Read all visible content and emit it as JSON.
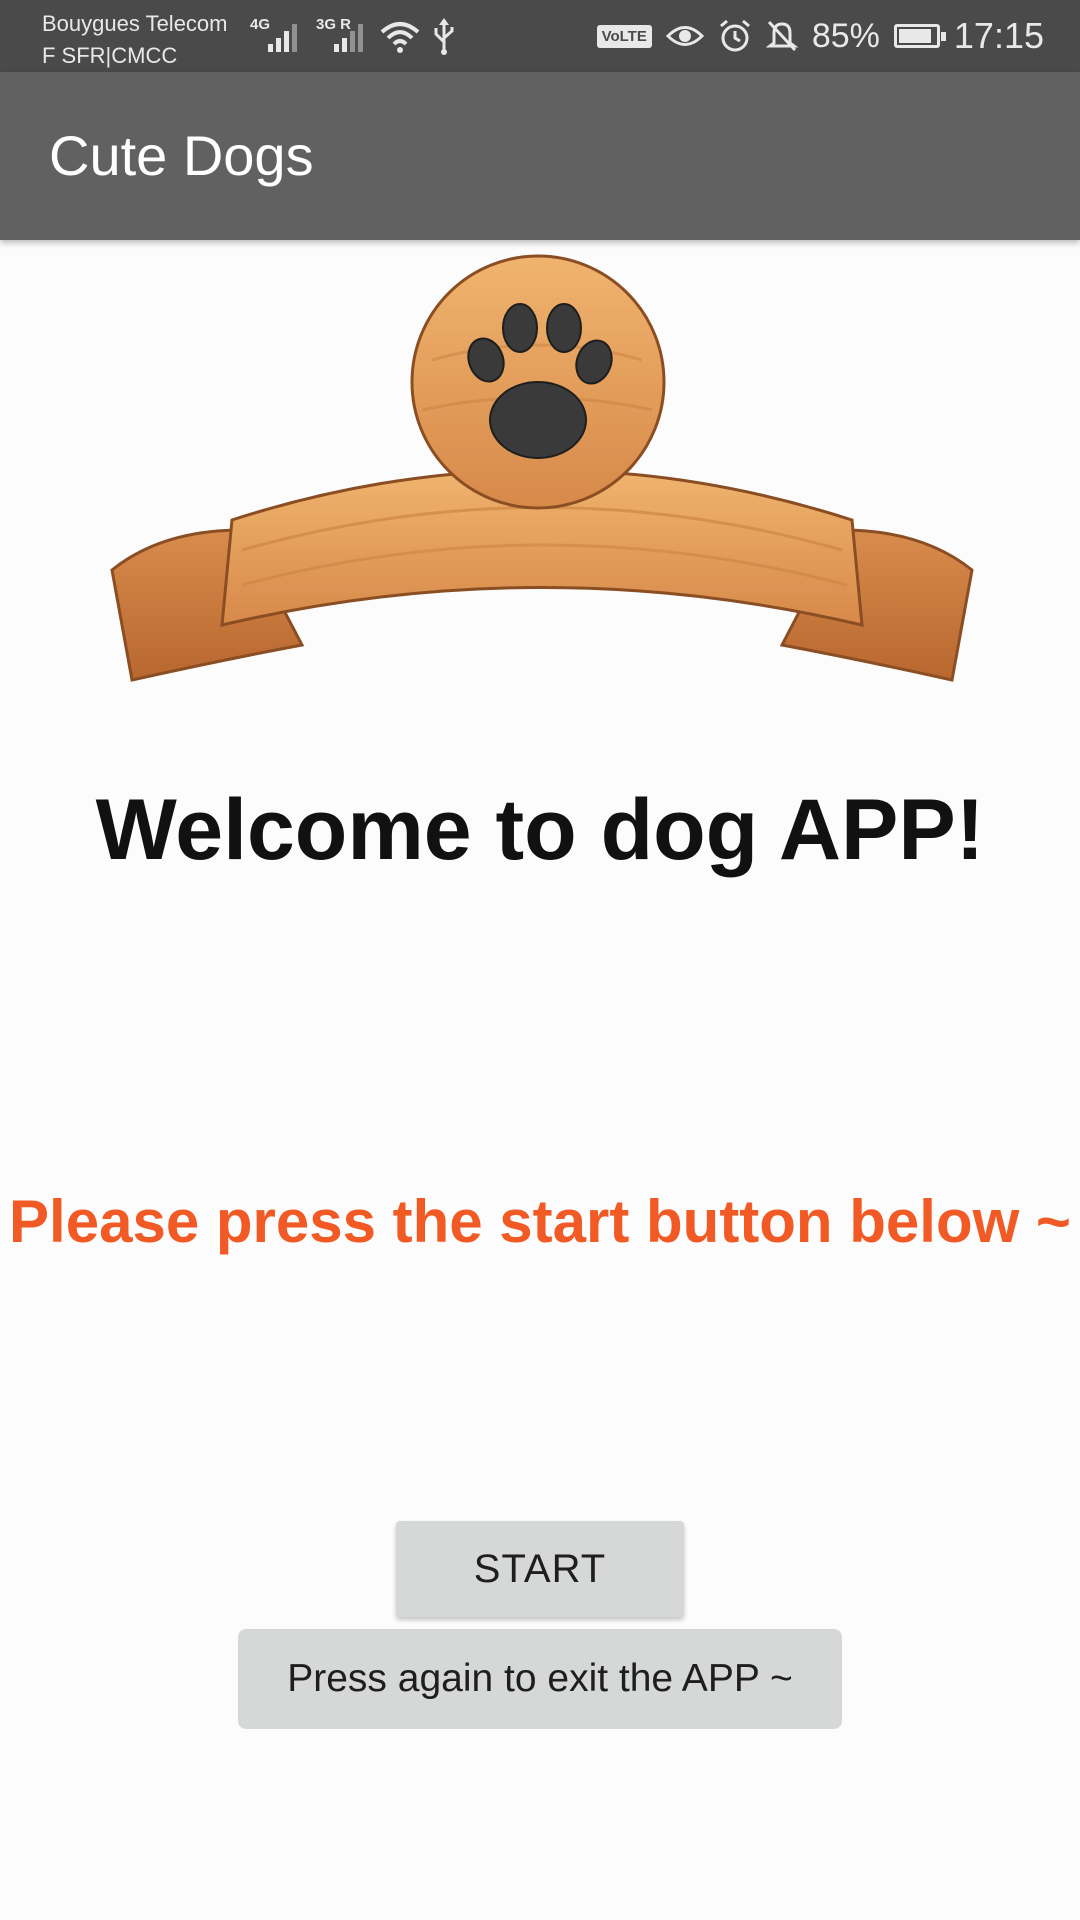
{
  "status_bar": {
    "carrier_line1": "Bouygues Telecom",
    "carrier_line2": "F SFR|CMCC",
    "network1": "4G",
    "network2": "3G R",
    "volte": "VoLTE",
    "battery": "85%",
    "time": "17:15"
  },
  "app_bar": {
    "title": "Cute Dogs"
  },
  "main": {
    "welcome": "Welcome to dog APP!",
    "prompt": "Please press the start button below ~",
    "start_button": "START",
    "exit_hint": "Press again to exit the APP ~"
  },
  "colors": {
    "status_bar": "#4a4a4a",
    "app_bar": "#616161",
    "prompt": "#f15a24",
    "button": "#d6d7d7"
  }
}
